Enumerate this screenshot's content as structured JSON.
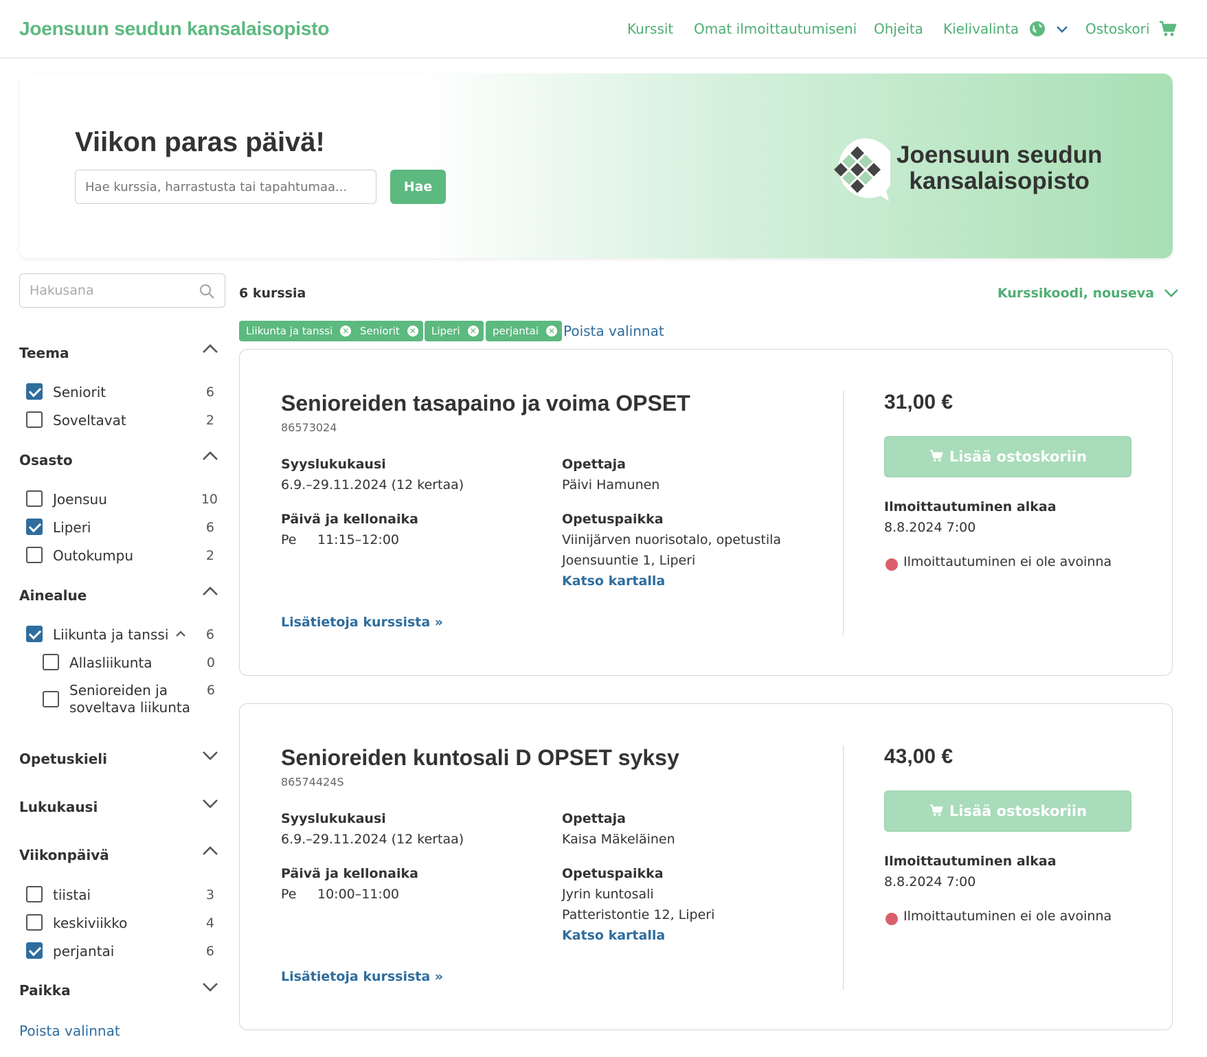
{
  "header": {
    "brand": "Joensuun seudun kansalaisopisto",
    "nav": {
      "courses": "Kurssit",
      "my_enrollments": "Omat ilmoittautumiseni",
      "help": "Ohjeita",
      "language": "Kielivalinta",
      "cart": "Ostoskori"
    }
  },
  "hero": {
    "title": "Viikon paras päivä!",
    "search_placeholder": "Hae kurssia, harrastusta tai tapahtumaa...",
    "search_button": "Hae",
    "logo_text_line1": "Joensuun seudun",
    "logo_text_line2": "kansalaisopisto"
  },
  "sidebar": {
    "search_placeholder": "Hakusana",
    "facets": {
      "teema": {
        "title": "Teema",
        "options": [
          {
            "label": "Seniorit",
            "count": "6",
            "checked": true
          },
          {
            "label": "Soveltavat",
            "count": "2",
            "checked": false
          }
        ]
      },
      "osasto": {
        "title": "Osasto",
        "options": [
          {
            "label": "Joensuu",
            "count": "10",
            "checked": false
          },
          {
            "label": "Liperi",
            "count": "6",
            "checked": true
          },
          {
            "label": "Outokumpu",
            "count": "2",
            "checked": false
          }
        ]
      },
      "ainealue": {
        "title": "Ainealue",
        "options": [
          {
            "label": "Liikunta ja tanssi",
            "count": "6",
            "checked": true
          },
          {
            "label": "Allasliikunta",
            "count": "0",
            "checked": false
          },
          {
            "label": "Senioreiden ja",
            "label2": "soveltava liikunta",
            "count": "6",
            "checked": false
          }
        ]
      },
      "opetuskieli": {
        "title": "Opetuskieli"
      },
      "lukukausi": {
        "title": "Lukukausi"
      },
      "viikonpaiva": {
        "title": "Viikonpäivä",
        "options": [
          {
            "label": "tiistai",
            "count": "3",
            "checked": false
          },
          {
            "label": "keskiviikko",
            "count": "4",
            "checked": false
          },
          {
            "label": "perjantai",
            "count": "6",
            "checked": true
          }
        ]
      },
      "paikka": {
        "title": "Paikka"
      }
    },
    "reset": "Poista valinnat"
  },
  "results": {
    "count": "6 kurssia",
    "sort": "Kurssikoodi, nouseva",
    "chips": [
      "Liikunta ja tanssi",
      "Seniorit",
      "Liperi",
      "perjantai"
    ],
    "clear": "Poista valinnat"
  },
  "courses": [
    {
      "title": "Senioreiden tasapaino ja voima OPSET",
      "code": "86573024",
      "term_label": "Syyslukukausi",
      "term_value": "6.9.–29.11.2024 (12 kertaa)",
      "time_label": "Päivä ja kellonaika",
      "day": "Pe",
      "time": "11:15–12:00",
      "teacher_label": "Opettaja",
      "teacher": "Päivi Hamunen",
      "place_label": "Opetuspaikka",
      "place_line1": "Viinijärven nuorisotalo, opetustila",
      "place_line2": "Joensuuntie 1, Liperi",
      "map_link": "Katso kartalla",
      "more_link": "Lisätietoja kurssista »",
      "price": "31,00 €",
      "cart_button": "Lisää ostoskoriin",
      "enroll_label": "Ilmoittautuminen alkaa",
      "enroll_date": "8.8.2024 7:00",
      "status": "Ilmoittautuminen ei ole avoinna"
    },
    {
      "title": "Senioreiden kuntosali D OPSET syksy",
      "code": "86574424S",
      "term_label": "Syyslukukausi",
      "term_value": "6.9.–29.11.2024 (12 kertaa)",
      "time_label": "Päivä ja kellonaika",
      "day": "Pe",
      "time": "10:00–11:00",
      "teacher_label": "Opettaja",
      "teacher": "Kaisa Mäkeläinen",
      "place_label": "Opetuspaikka",
      "place_line1": "Jyrin kuntosali",
      "place_line2": "Patteristontie 12, Liperi",
      "map_link": "Katso kartalla",
      "more_link": "Lisätietoja kurssista »",
      "price": "43,00 €",
      "cart_button": "Lisää ostoskoriin",
      "enroll_label": "Ilmoittautuminen alkaa",
      "enroll_date": "8.8.2024 7:00",
      "status": "Ilmoittautuminen ei ole avoinna"
    }
  ],
  "colors": {
    "brand_green": "#5cb97f",
    "link_blue": "#2f6d9e",
    "status_red": "#d9606b"
  }
}
